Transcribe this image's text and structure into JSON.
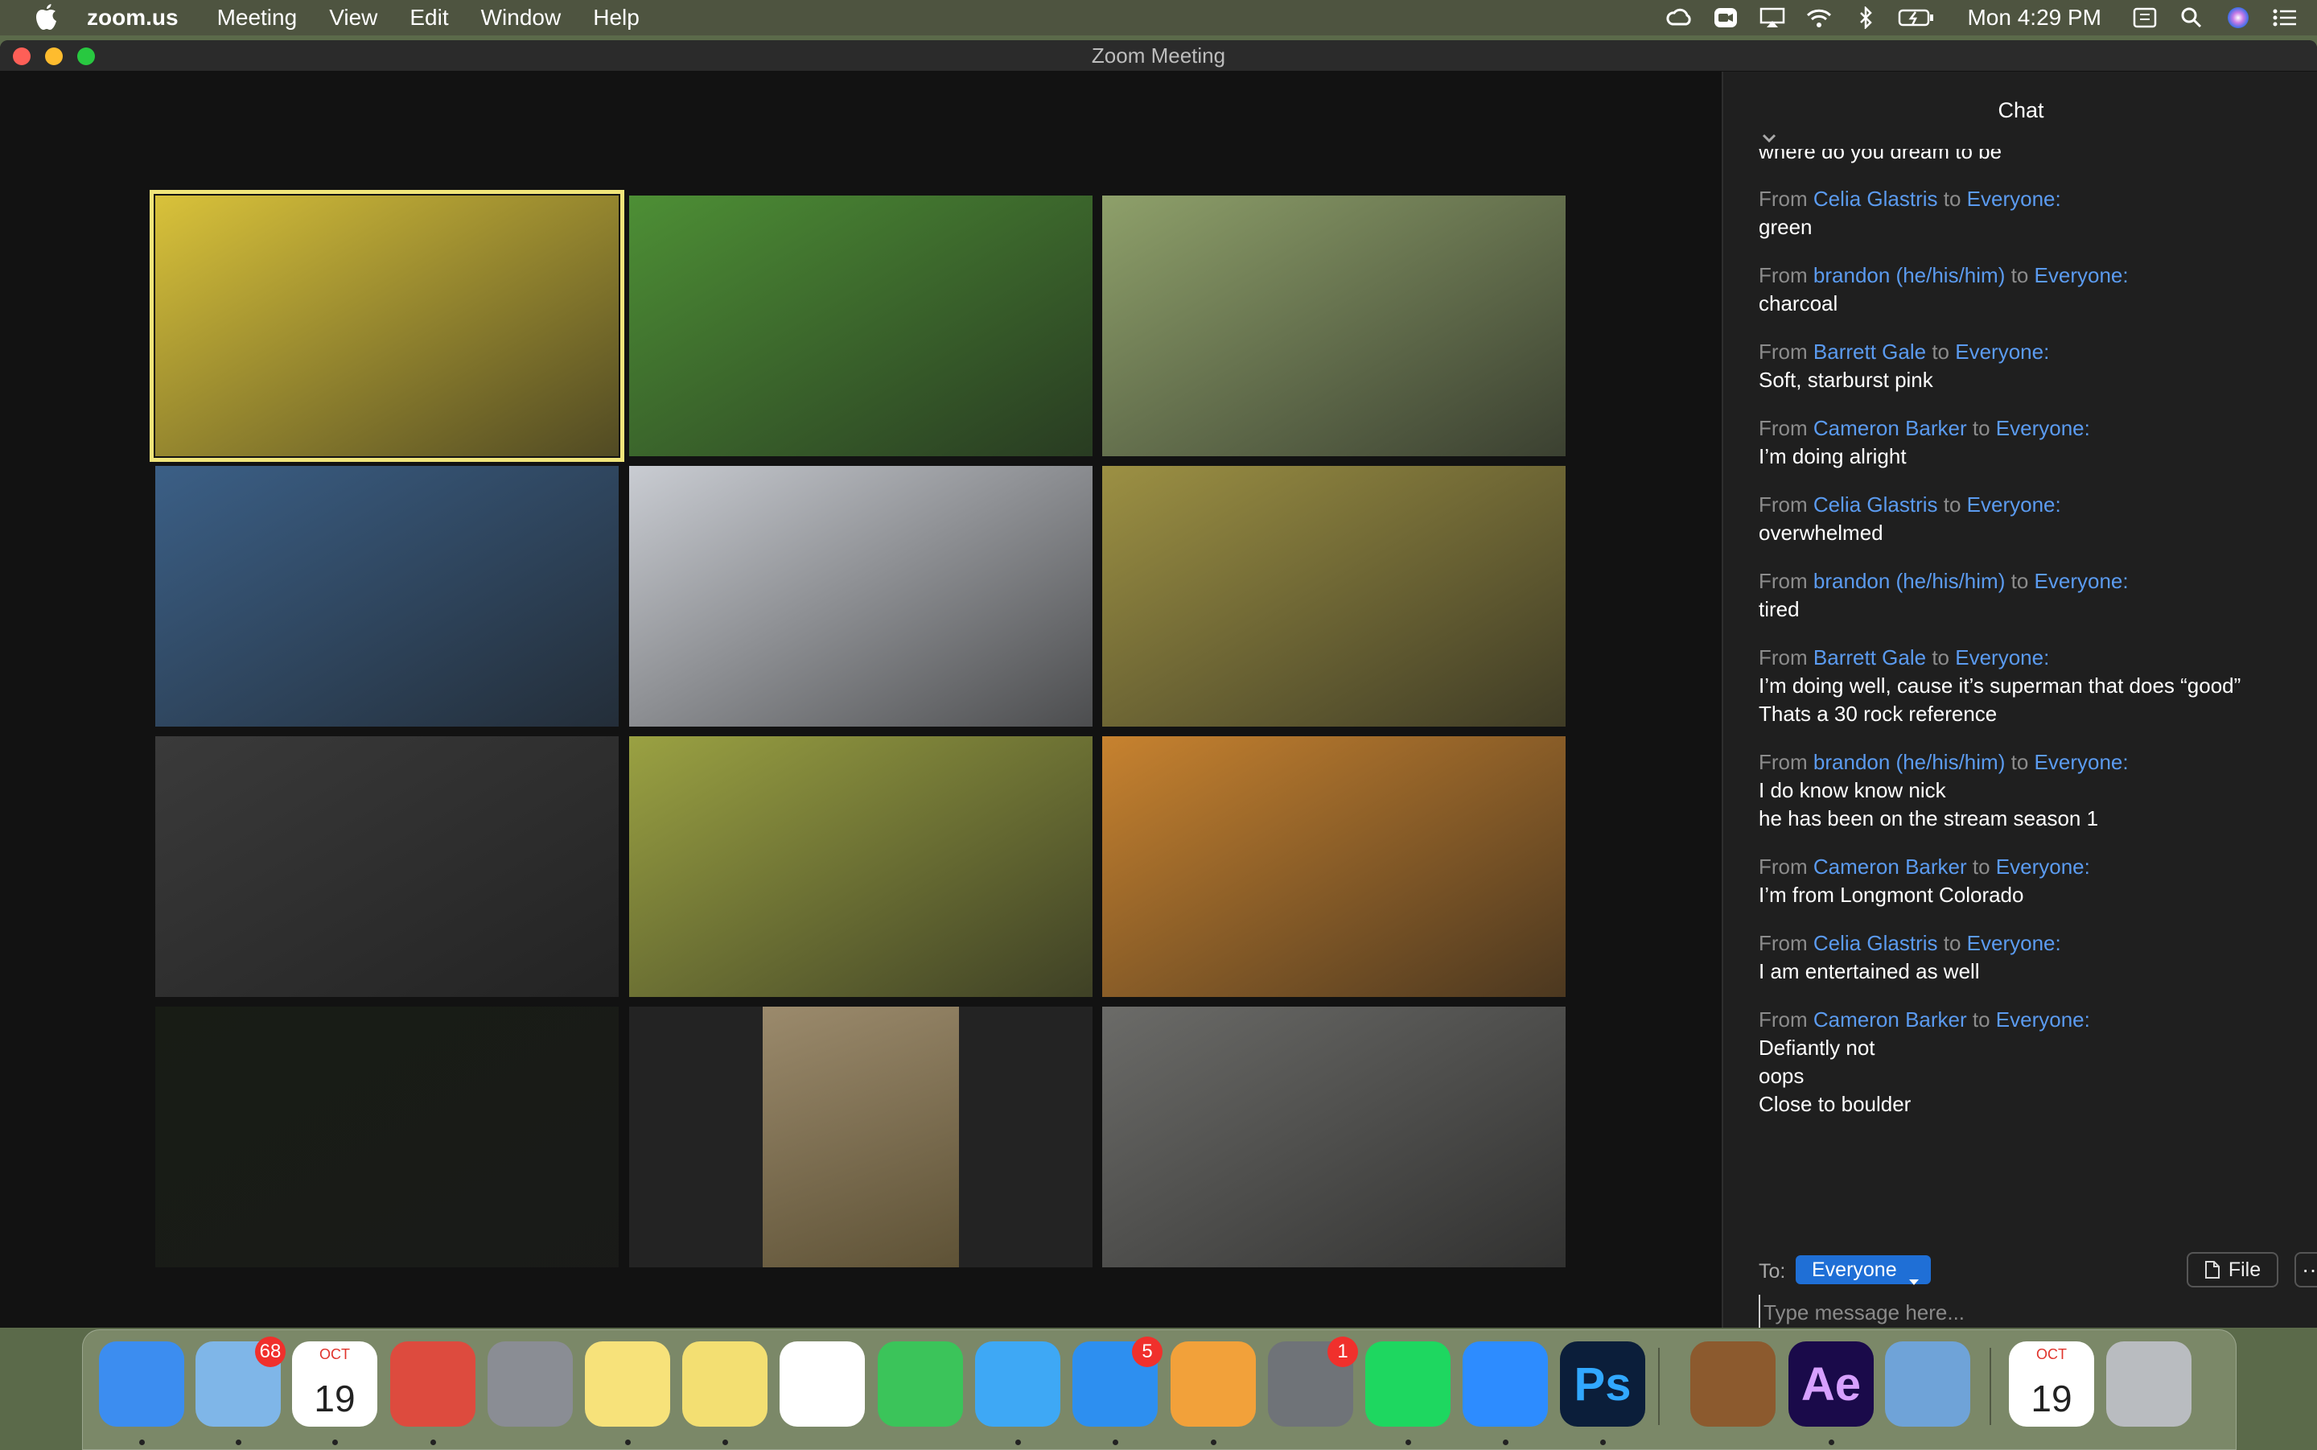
{
  "menubar": {
    "app_name": "zoom.us",
    "menus": [
      "Meeting",
      "View",
      "Edit",
      "Window",
      "Help"
    ],
    "clock": "Mon 4:29 PM"
  },
  "window": {
    "title": "Zoom Meeting"
  },
  "video_tiles": [
    {
      "color": "#d9c23a",
      "active": true
    },
    {
      "color": "#4d8f35"
    },
    {
      "color": "#8ea06a"
    },
    {
      "color": "#3b5f86"
    },
    {
      "color": "#c9ccd2"
    },
    {
      "color": "#9c9043"
    },
    {
      "color": "#3a3a3a"
    },
    {
      "color": "#9aa142"
    },
    {
      "color": "#c7822f"
    },
    {
      "color": "#181c15"
    },
    {
      "color": "#9b8a6c"
    },
    {
      "color": "#6b6b68"
    }
  ],
  "chat": {
    "header": "Chat",
    "partial_top_message": "where do you dream to be",
    "from_label": "From",
    "to_word": "to",
    "messages": [
      {
        "sender": "Celia Glastris",
        "recipient": "Everyone:",
        "lines": [
          "green"
        ]
      },
      {
        "sender": "brandon (he/his/him)",
        "recipient": "Everyone:",
        "lines": [
          "charcoal"
        ]
      },
      {
        "sender": "Barrett Gale",
        "recipient": "Everyone:",
        "lines": [
          "Soft, starburst pink"
        ]
      },
      {
        "sender": "Cameron Barker",
        "recipient": "Everyone:",
        "lines": [
          "I’m doing alright"
        ]
      },
      {
        "sender": "Celia Glastris",
        "recipient": "Everyone:",
        "lines": [
          "overwhelmed"
        ]
      },
      {
        "sender": "brandon (he/his/him)",
        "recipient": "Everyone:",
        "lines": [
          "tired"
        ]
      },
      {
        "sender": "Barrett Gale",
        "recipient": "Everyone:",
        "lines": [
          "I’m doing well, cause it’s superman that does “good”",
          "Thats a 30 rock reference"
        ]
      },
      {
        "sender": "brandon (he/his/him)",
        "recipient": "Everyone:",
        "lines": [
          "I do know know nick",
          "he has been on the stream season 1"
        ]
      },
      {
        "sender": "Cameron Barker",
        "recipient": "Everyone:",
        "lines": [
          "I’m from Longmont Colorado"
        ]
      },
      {
        "sender": "Celia Glastris",
        "recipient": "Everyone:",
        "lines": [
          "I am entertained as well"
        ]
      },
      {
        "sender": "Cameron Barker",
        "recipient": "Everyone:",
        "lines": [
          "Defiantly not",
          "oops",
          "Close to boulder"
        ]
      }
    ],
    "to_label": "To:",
    "to_value": "Everyone",
    "file_label": "File",
    "more_label": "···",
    "input_placeholder": "Type message here..."
  },
  "dock": {
    "apps": [
      {
        "name": "finder",
        "color": "#3c8df0",
        "running": true
      },
      {
        "name": "mail",
        "color": "#7fb6e8",
        "badge": "68",
        "running": true
      },
      {
        "name": "calendar",
        "color": "#ffffff",
        "label": "19",
        "sublabel": "OCT",
        "running": true
      },
      {
        "name": "chrome",
        "color": "#dd4b3e",
        "running": true
      },
      {
        "name": "launchpad",
        "color": "#8a8d94",
        "running": false
      },
      {
        "name": "notes",
        "color": "#f7e27a",
        "running": true
      },
      {
        "name": "stickies",
        "color": "#f3df72",
        "running": true
      },
      {
        "name": "reminders",
        "color": "#ffffff",
        "running": false
      },
      {
        "name": "facetime",
        "color": "#3bc45a",
        "running": false
      },
      {
        "name": "messages",
        "color": "#3ea8f5",
        "running": true
      },
      {
        "name": "app-store",
        "color": "#2d8ff0",
        "badge": "5",
        "running": true
      },
      {
        "name": "pages",
        "color": "#f2a13a",
        "running": true
      },
      {
        "name": "system-preferences",
        "color": "#6f7378",
        "badge": "1",
        "running": false
      },
      {
        "name": "spotify",
        "color": "#1ed760",
        "running": true
      },
      {
        "name": "zoom",
        "color": "#2d8cff",
        "running": true
      },
      {
        "name": "photoshop",
        "color": "#0b1e3a",
        "label": "Ps",
        "running": true
      },
      {
        "name": "garageband",
        "color": "#8c5a2e",
        "running": false
      },
      {
        "name": "after-effects",
        "color": "#1a0a4a",
        "label": "Ae",
        "running": true
      },
      {
        "name": "preview",
        "color": "#6fa3d8",
        "running": false
      },
      {
        "name": "calendar-doc",
        "color": "#ffffff",
        "label": "19",
        "sublabel": "OCT",
        "running": false
      },
      {
        "name": "trash",
        "color": "#b9bcc0",
        "running": false
      }
    ]
  }
}
